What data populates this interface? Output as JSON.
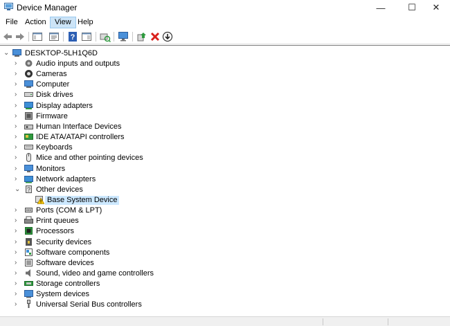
{
  "window": {
    "title": "Device Manager",
    "minimize_glyph": "—",
    "maximize_glyph": "☐",
    "close_glyph": "✕"
  },
  "menu": [
    "File",
    "Action",
    "View",
    "Help"
  ],
  "active_menu": "View",
  "toolbar": {
    "buttons": [
      "back-arrow-icon",
      "forward-arrow-icon",
      "show-hide-console-tree-icon",
      "properties-icon",
      "help-icon",
      "action-pane-icon",
      "scan-hardware-changes-icon",
      "computer-monitor-icon",
      "update-driver-icon",
      "uninstall-device-icon",
      "disable-device-icon"
    ]
  },
  "tree": {
    "root": "DESKTOP-5LH1Q6D",
    "items": [
      {
        "label": "Audio inputs and outputs",
        "icon": "speaker-icon",
        "expanded": false
      },
      {
        "label": "Cameras",
        "icon": "camera-icon",
        "expanded": false
      },
      {
        "label": "Computer",
        "icon": "computer-icon",
        "expanded": false
      },
      {
        "label": "Disk drives",
        "icon": "disk-drive-icon",
        "expanded": false
      },
      {
        "label": "Display adapters",
        "icon": "display-adapter-icon",
        "expanded": false
      },
      {
        "label": "Firmware",
        "icon": "firmware-icon",
        "expanded": false
      },
      {
        "label": "Human Interface Devices",
        "icon": "hid-icon",
        "expanded": false
      },
      {
        "label": "IDE ATA/ATAPI controllers",
        "icon": "ide-controller-icon",
        "expanded": false
      },
      {
        "label": "Keyboards",
        "icon": "keyboard-icon",
        "expanded": false
      },
      {
        "label": "Mice and other pointing devices",
        "icon": "mouse-icon",
        "expanded": false
      },
      {
        "label": "Monitors",
        "icon": "monitor-icon",
        "expanded": false
      },
      {
        "label": "Network adapters",
        "icon": "network-adapter-icon",
        "expanded": false
      },
      {
        "label": "Other devices",
        "icon": "other-devices-icon",
        "expanded": true
      },
      {
        "label": "Base System Device",
        "icon": "warning-device-icon",
        "child": true,
        "selected": true
      },
      {
        "label": "Ports (COM & LPT)",
        "icon": "port-icon",
        "expanded": false
      },
      {
        "label": "Print queues",
        "icon": "printer-icon",
        "expanded": false
      },
      {
        "label": "Processors",
        "icon": "processor-icon",
        "expanded": false
      },
      {
        "label": "Security devices",
        "icon": "security-device-icon",
        "expanded": false
      },
      {
        "label": "Software components",
        "icon": "software-component-icon",
        "expanded": false
      },
      {
        "label": "Software devices",
        "icon": "software-device-icon",
        "expanded": false
      },
      {
        "label": "Sound, video and game controllers",
        "icon": "sound-controller-icon",
        "expanded": false
      },
      {
        "label": "Storage controllers",
        "icon": "storage-controller-icon",
        "expanded": false
      },
      {
        "label": "System devices",
        "icon": "system-device-icon",
        "expanded": false
      },
      {
        "label": "Universal Serial Bus controllers",
        "icon": "usb-icon",
        "expanded": false
      }
    ]
  },
  "colors": {
    "selection": "#cce8ff",
    "menu_active": "#cce4f7",
    "folder_blue": "#3c8fd6",
    "warning_yellow": "#f5c400",
    "uninstall_red": "#d9201c",
    "update_green": "#2e9a3e"
  }
}
